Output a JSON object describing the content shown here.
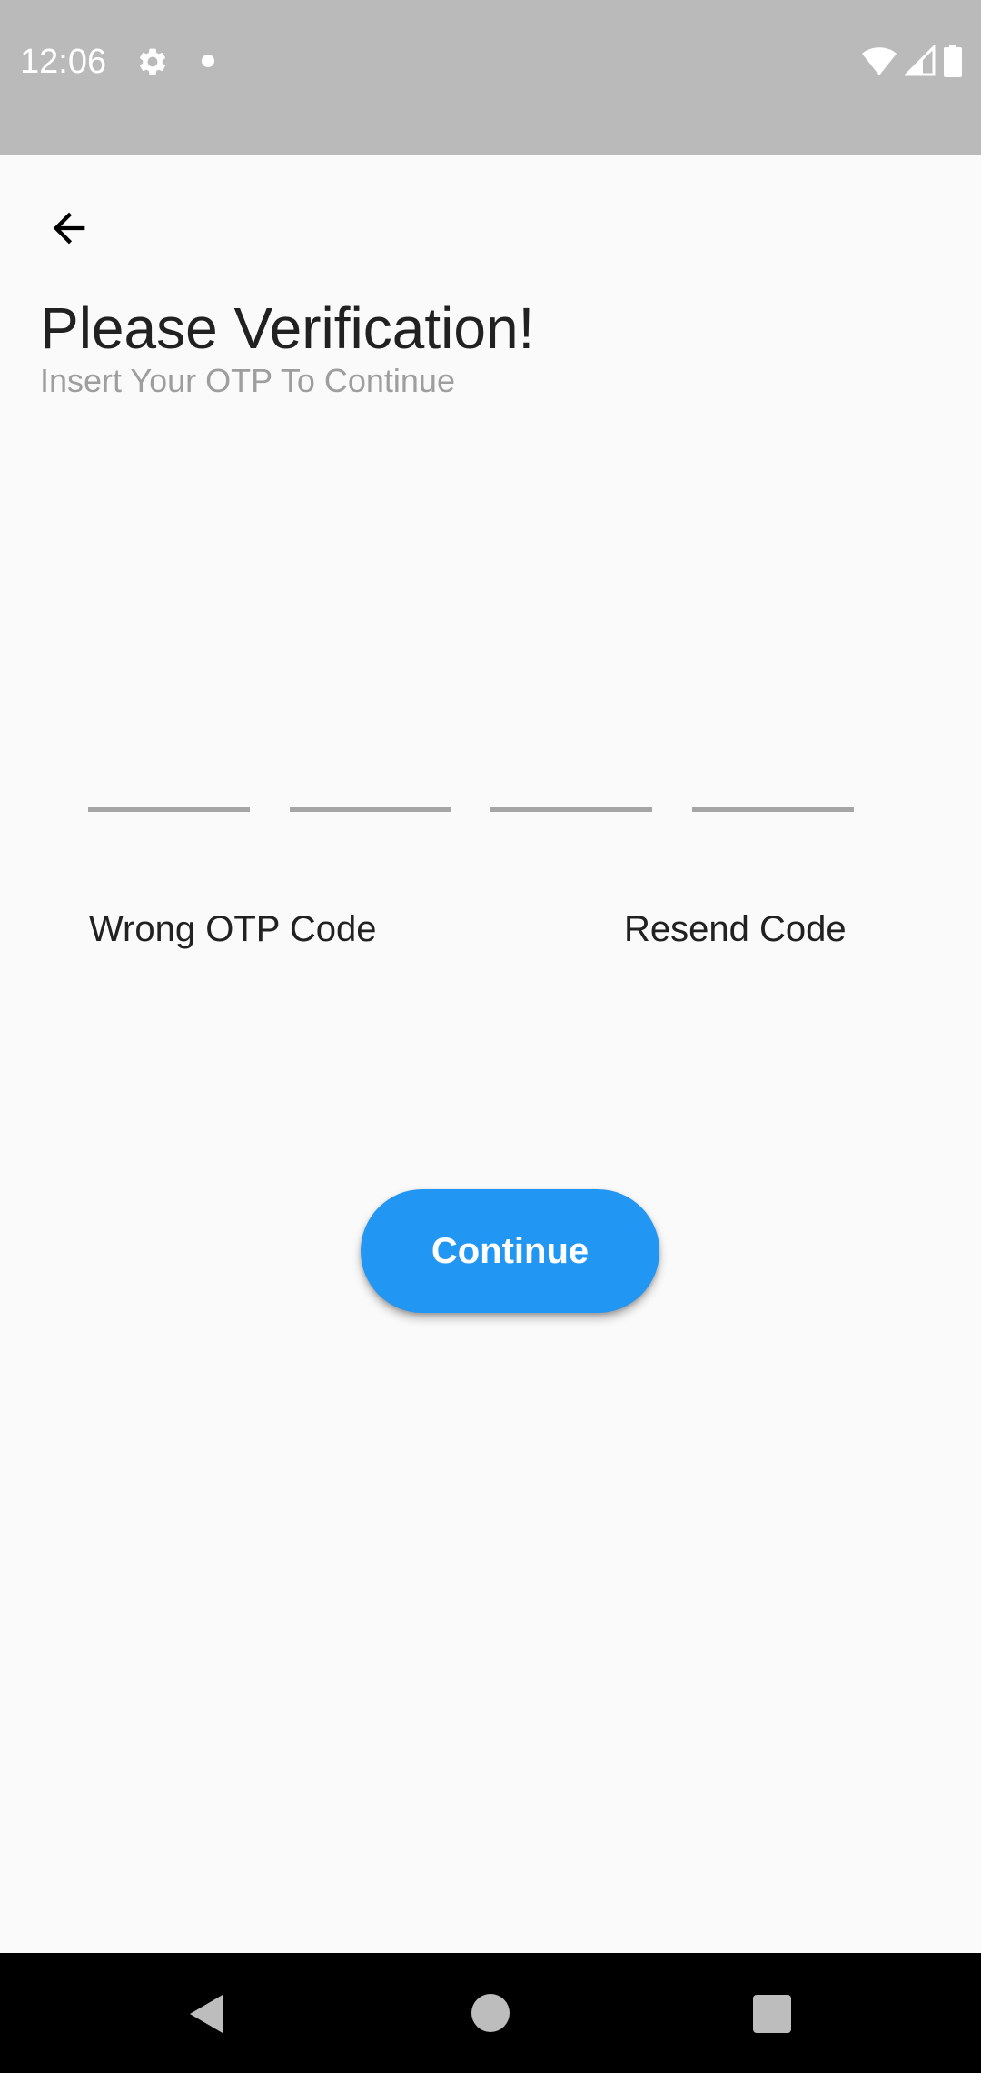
{
  "status_bar": {
    "time": "12:06",
    "icons": [
      "gear-icon",
      "notification-dot-icon",
      "wifi-icon",
      "signal-icon",
      "battery-icon"
    ]
  },
  "header": {
    "back_icon": "arrow-back-icon",
    "title": "Please Verification!",
    "subtitle": "Insert Your OTP To Continue"
  },
  "otp": {
    "fields": [
      {
        "value": ""
      },
      {
        "value": ""
      },
      {
        "value": ""
      },
      {
        "value": ""
      }
    ]
  },
  "links": {
    "wrong_code": "Wrong OTP Code",
    "resend": "Resend Code"
  },
  "actions": {
    "continue_label": "Continue"
  },
  "nav_bar": {
    "icons": [
      "nav-back-icon",
      "nav-home-icon",
      "nav-recents-icon"
    ]
  },
  "colors": {
    "status_bar_bg": "#bababa",
    "page_bg": "#fafafa",
    "accent": "#2196f3",
    "title_text": "#212121",
    "subtitle_text": "#9e9e9e",
    "otp_underline": "#a6a6a6",
    "nav_bar_bg": "#000000"
  }
}
